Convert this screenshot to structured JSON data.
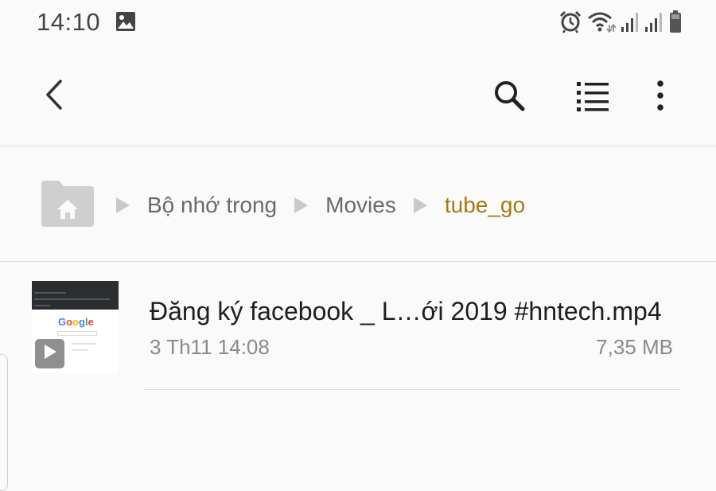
{
  "status_bar": {
    "time": "14:10",
    "icons": [
      "gallery-icon",
      "alarm-icon",
      "wifi-icon",
      "signal-icon",
      "signal-icon",
      "battery-icon"
    ]
  },
  "toolbar": {
    "icons": [
      "back-icon",
      "search-icon",
      "list-view-icon",
      "more-icon"
    ]
  },
  "breadcrumb": {
    "home_icon": "home-folder-icon",
    "items": [
      "Bộ nhớ trong",
      "Movies",
      "tube_go"
    ],
    "current_color": "#a67c12"
  },
  "files": [
    {
      "name": "Đăng ký facebook _ L…ới 2019 #hntech.mp4",
      "date": "3 Th11 14:08",
      "size": "7,35 MB",
      "thumbnail": {
        "logo_text": "Google",
        "badge_icon": "play-icon"
      }
    }
  ]
}
